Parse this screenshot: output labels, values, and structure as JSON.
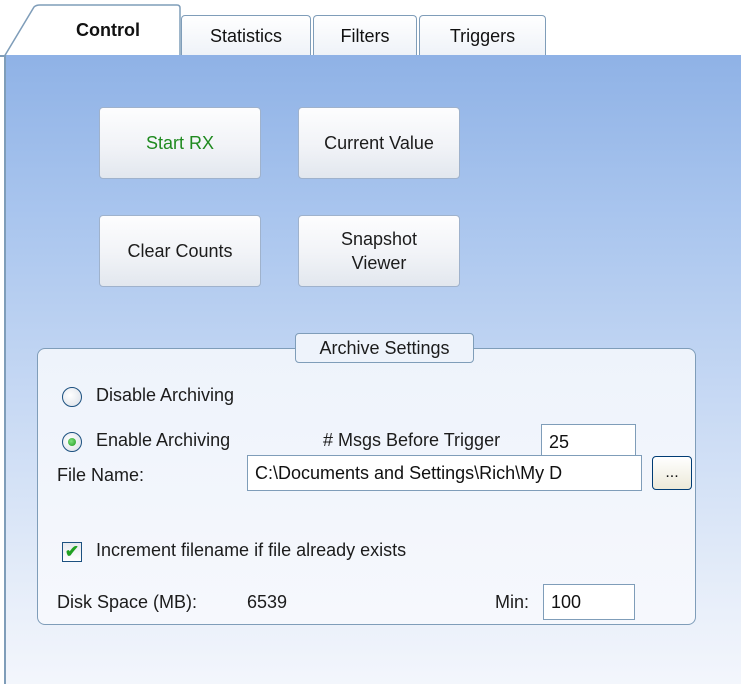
{
  "tabs": [
    {
      "label": "Control",
      "active": true
    },
    {
      "label": "Statistics",
      "active": false
    },
    {
      "label": "Filters",
      "active": false
    },
    {
      "label": "Triggers",
      "active": false
    }
  ],
  "buttons": {
    "start_rx": "Start RX",
    "current_value": "Current Value",
    "clear_counts": "Clear Counts",
    "snapshot_viewer": "Snapshot Viewer"
  },
  "archive": {
    "title": "Archive Settings",
    "disable_label": "Disable Archiving",
    "enable_label": "Enable Archiving",
    "selected": "enable",
    "msgs_before_trigger_label": "# Msgs Before Trigger",
    "msgs_before_trigger_value": "25",
    "file_name_label": "File Name:",
    "file_name_value": "C:\\Documents and Settings\\Rich\\My D",
    "browse_label": "...",
    "increment_label": "Increment filename if file already exists",
    "increment_checked": true,
    "disk_space_label": "Disk Space (MB):",
    "disk_space_value": "6539",
    "min_label": "Min:",
    "min_value": "100"
  },
  "colors": {
    "start_rx_text": "#1f8a1f",
    "panel_top": "#8fb2e6",
    "border": "#7f9db9"
  }
}
